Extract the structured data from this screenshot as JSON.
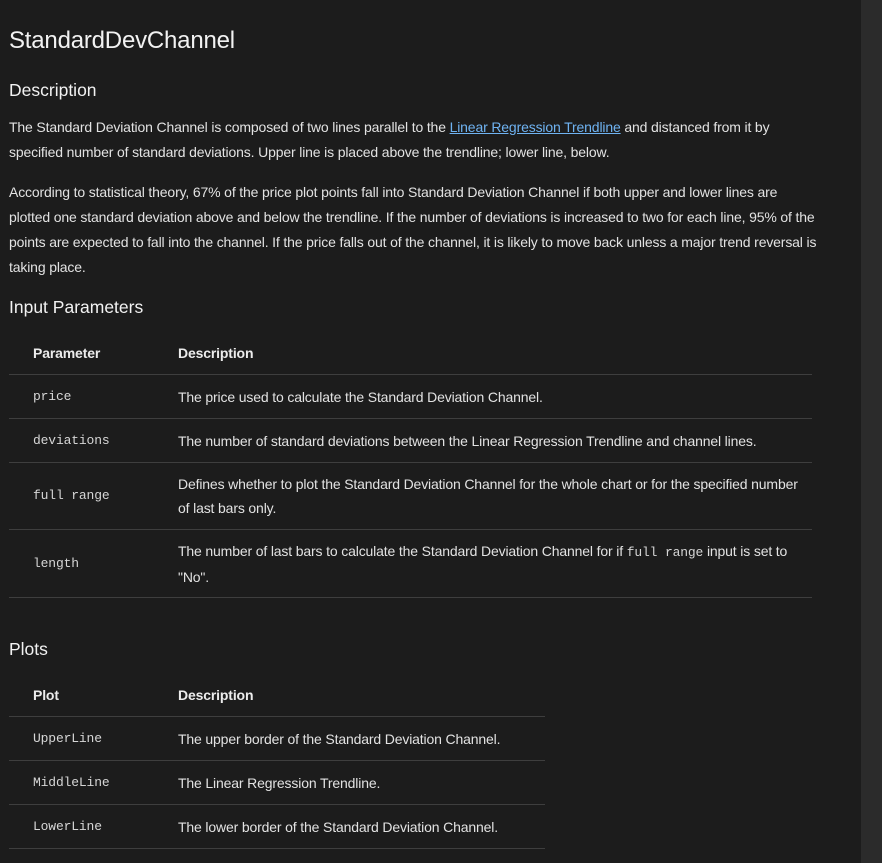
{
  "page_title": "StandardDevChannel",
  "description": {
    "heading": "Description",
    "p1_before": "The Standard Deviation Channel is composed of two lines parallel to the ",
    "p1_link": "Linear Regression Trendline",
    "p1_after": " and distanced from it by specified number of standard deviations. Upper line is placed above the trendline; lower line, below.",
    "p2": "According to statistical theory, 67% of the price plot points fall into Standard Deviation Channel if both upper and lower lines are plotted one standard deviation above and below the trendline. If the number of deviations is increased to two for each line, 95% of the points are expected to fall into the channel. If the price falls out of the channel, it is likely to move back unless a major trend reversal is taking place."
  },
  "inputs": {
    "heading": "Input Parameters",
    "col_parameter": "Parameter",
    "col_description": "Description",
    "rows": [
      {
        "name": "price",
        "desc": "The price used to calculate the Standard Deviation Channel."
      },
      {
        "name": "deviations",
        "desc": "The number of standard deviations between the Linear Regression Trendline and channel lines."
      },
      {
        "name": "full range",
        "desc": "Defines whether to plot the Standard Deviation Channel for the whole chart or for the specified number of last bars only."
      },
      {
        "name": "length",
        "desc_before": "The number of last bars to calculate the Standard Deviation Channel for if ",
        "desc_code": "full range",
        "desc_after": " input is set to \"No\"."
      }
    ]
  },
  "plots": {
    "heading": "Plots",
    "col_plot": "Plot",
    "col_description": "Description",
    "rows": [
      {
        "name": "UpperLine",
        "desc": "The upper border of the Standard Deviation Channel."
      },
      {
        "name": "MiddleLine",
        "desc": "The Linear Regression Trendline."
      },
      {
        "name": "LowerLine",
        "desc": "The lower border of the Standard Deviation Channel."
      }
    ]
  }
}
